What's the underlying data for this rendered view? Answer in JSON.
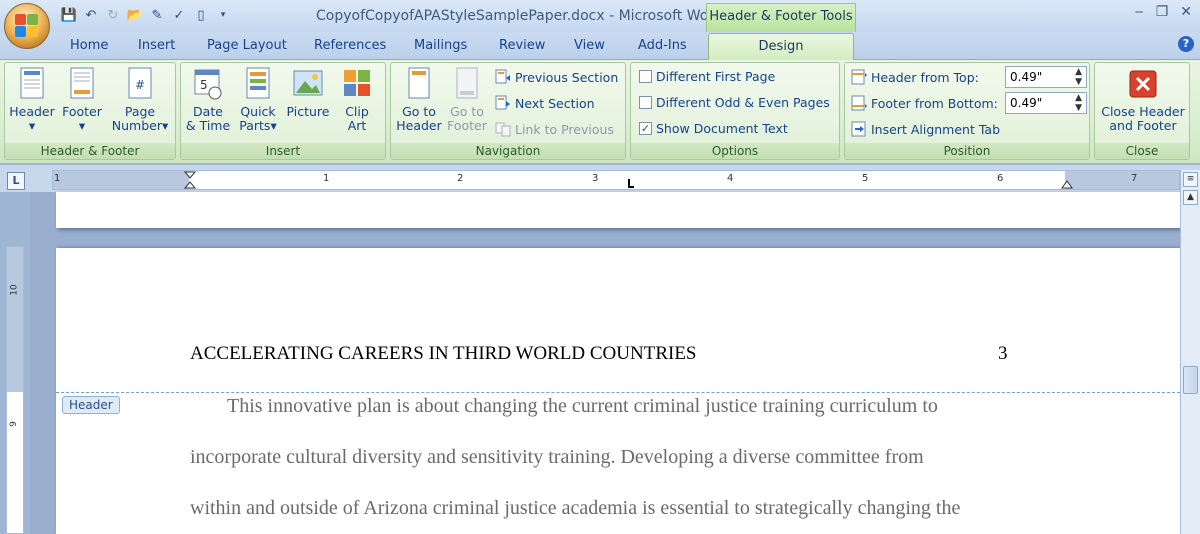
{
  "window": {
    "doc_title": "CopyofCopyofAPAStyleSamplePaper.docx - Microsoft Word",
    "context_title": "Header & Footer Tools"
  },
  "tabs": [
    "Home",
    "Insert",
    "Page Layout",
    "References",
    "Mailings",
    "Review",
    "View",
    "Add-Ins"
  ],
  "active_tab": "Design",
  "ribbon": {
    "header_footer": {
      "header": "Header",
      "footer": "Footer",
      "page_number_1": "Page",
      "page_number_2": "Number",
      "label": "Header & Footer"
    },
    "insert": {
      "date_1": "Date",
      "date_2": "& Time",
      "quick_1": "Quick",
      "quick_2": "Parts",
      "picture": "Picture",
      "clip_1": "Clip",
      "clip_2": "Art",
      "label": "Insert"
    },
    "navigation": {
      "goto_header_1": "Go to",
      "goto_header_2": "Header",
      "goto_footer_1": "Go to",
      "goto_footer_2": "Footer",
      "prev_section": "Previous Section",
      "next_section": "Next Section",
      "link_previous": "Link to Previous",
      "label": "Navigation"
    },
    "options": {
      "diff_first": "Different First Page",
      "diff_odd_even": "Different Odd & Even Pages",
      "show_doc_text": "Show Document Text",
      "label": "Options"
    },
    "position": {
      "header_from_top": "Header from Top:",
      "header_value": "0.49\"",
      "footer_from_bottom": "Footer from Bottom:",
      "footer_value": "0.49\"",
      "insert_align_tab": "Insert Alignment Tab",
      "label": "Position"
    },
    "close": {
      "close_1": "Close Header",
      "close_2": "and Footer",
      "label": "Close"
    }
  },
  "ruler": {
    "numbers": [
      "1",
      "1",
      "2",
      "3",
      "4",
      "5",
      "6",
      "7"
    ]
  },
  "vruler": {
    "numbers": [
      "10",
      "9"
    ]
  },
  "document": {
    "header_text": "ACCELERATING CAREERS IN THIRD WORLD COUNTRIES",
    "header_page_number": "3",
    "header_tag": "Header",
    "body_lines": [
      "This innovative plan is about changing the current criminal justice training curriculum to",
      "incorporate cultural diversity and sensitivity training. Developing a diverse committee from",
      "within and outside of Arizona criminal justice academia is essential to strategically changing the"
    ]
  }
}
